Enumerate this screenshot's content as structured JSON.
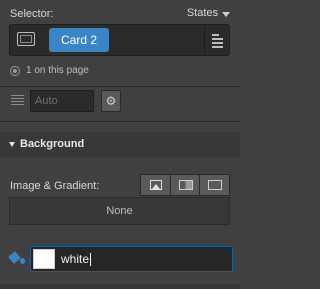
{
  "selector": {
    "title": "Selector:",
    "states_label": "States",
    "class_chip": "Card 2",
    "element_icon": "element-box-icon",
    "menu_icon": "align-menu-icon"
  },
  "match_info": {
    "icon": "target-icon",
    "text": "1 on this page"
  },
  "order_row": {
    "icon": "lines-icon",
    "placeholder": "Auto",
    "settings_icon": "gear-icon",
    "settings_glyph": "⚙"
  },
  "background_section": {
    "title": "Background",
    "image_gradient_label": "Image & Gradient:",
    "buttons": [
      "image-icon",
      "linear-gradient-icon",
      "radial-gradient-icon"
    ],
    "none_label": "None",
    "fill_icon": "paint-bucket-icon",
    "color_value": "white",
    "swatch_color": "#ffffff"
  },
  "colors": {
    "panel_bg": "#404040",
    "accent": "#3b84c6",
    "input_bg": "#2b2b2b"
  }
}
